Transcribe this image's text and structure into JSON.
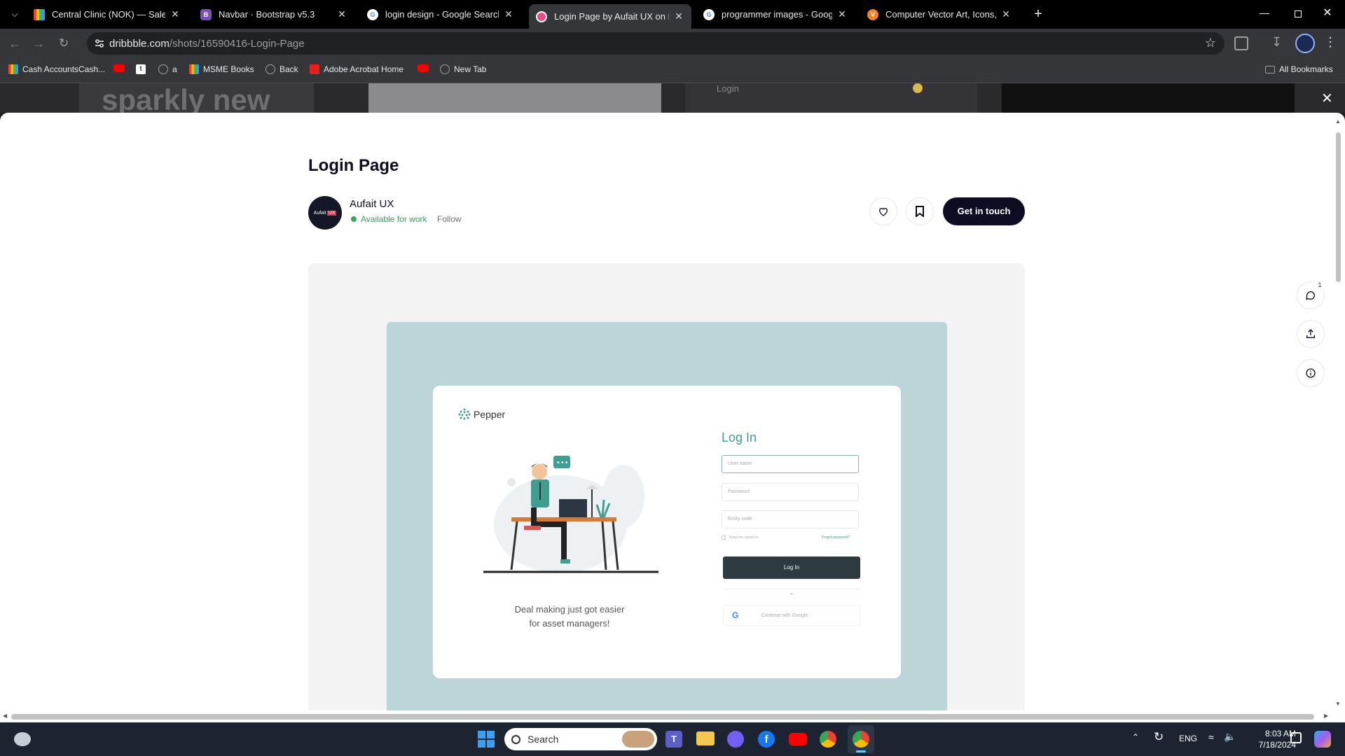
{
  "tabs": [
    {
      "title": "Central Clinic (NOK) — Sales In",
      "icon": "app-grid-icon",
      "color": "#f2a700"
    },
    {
      "title": "Navbar · Bootstrap v5.3",
      "icon": "bootstrap-icon",
      "color": "#7952b3"
    },
    {
      "title": "login design - Google Search",
      "icon": "google-icon",
      "color": "#4285f4"
    },
    {
      "title": "Login Page by Aufait UX on Dri",
      "icon": "dribbble-icon",
      "color": "#ea4c89",
      "active": true
    },
    {
      "title": "programmer images - Google S",
      "icon": "google-icon",
      "color": "#4285f4"
    },
    {
      "title": "Computer Vector Art, Icons, and",
      "icon": "vecteezy-icon",
      "color": "#f58220"
    }
  ],
  "address": {
    "domain": "dribbble.com",
    "path": "/shots/16590416-Login-Page"
  },
  "bookmarks": [
    {
      "label": "Cash AccountsCash...",
      "icon": "app-grid-icon",
      "color": "#f2a700"
    },
    {
      "label": "",
      "icon": "youtube-icon",
      "color": "#ff0000"
    },
    {
      "label": "",
      "icon": "tumblr-icon",
      "color": "#ffffff"
    },
    {
      "label": "a",
      "icon": "globe-icon",
      "color": "#9aa0a6"
    },
    {
      "label": "MSME Books",
      "icon": "app-grid-icon",
      "color": "#f2a700"
    },
    {
      "label": "Back",
      "icon": "globe-icon",
      "color": "#9aa0a6"
    },
    {
      "label": "Adobe Acrobat Home",
      "icon": "acrobat-icon",
      "color": "#e62117"
    },
    {
      "label": "",
      "icon": "youtube-icon",
      "color": "#ff0000"
    },
    {
      "label": "New Tab",
      "icon": "globe-icon",
      "color": "#9aa0a6"
    }
  ],
  "all_bookmarks": "All Bookmarks",
  "bg_strip": {
    "text1": "sparkly new",
    "text2": "Login"
  },
  "shot": {
    "title": "Login Page",
    "author": "Aufait UX",
    "avatar_text": "Aufait",
    "avatar_badge": "UX",
    "availability": "Available for work",
    "follow": "Follow",
    "cta": "Get in touch",
    "comment_count": "1"
  },
  "design": {
    "brand": "Pepper",
    "heading": "Log In",
    "username_ph": "User name",
    "password_ph": "Password",
    "entity_ph": "Entity code",
    "keep_signed": "Keep me signed in",
    "forgot": "Forgot password?",
    "login_btn": "Log In",
    "or": "or",
    "google": "Continue with Google",
    "tagline1": "Deal making just got easier",
    "tagline2": "for asset managers!"
  },
  "taskbar": {
    "search": "Search",
    "lang": "ENG",
    "time": "8:03 AM",
    "date": "7/18/2024",
    "apps": [
      "windows-start-icon",
      "teams-icon",
      "file-explorer-icon",
      "viber-icon",
      "facebook-icon",
      "youtube-icon",
      "chrome-icon",
      "chrome-active-icon"
    ]
  },
  "colors": {
    "accent": "#0d0c22",
    "green": "#3a9a5b",
    "teal": "#3f9e8f",
    "panel": "#bcd5d9"
  }
}
